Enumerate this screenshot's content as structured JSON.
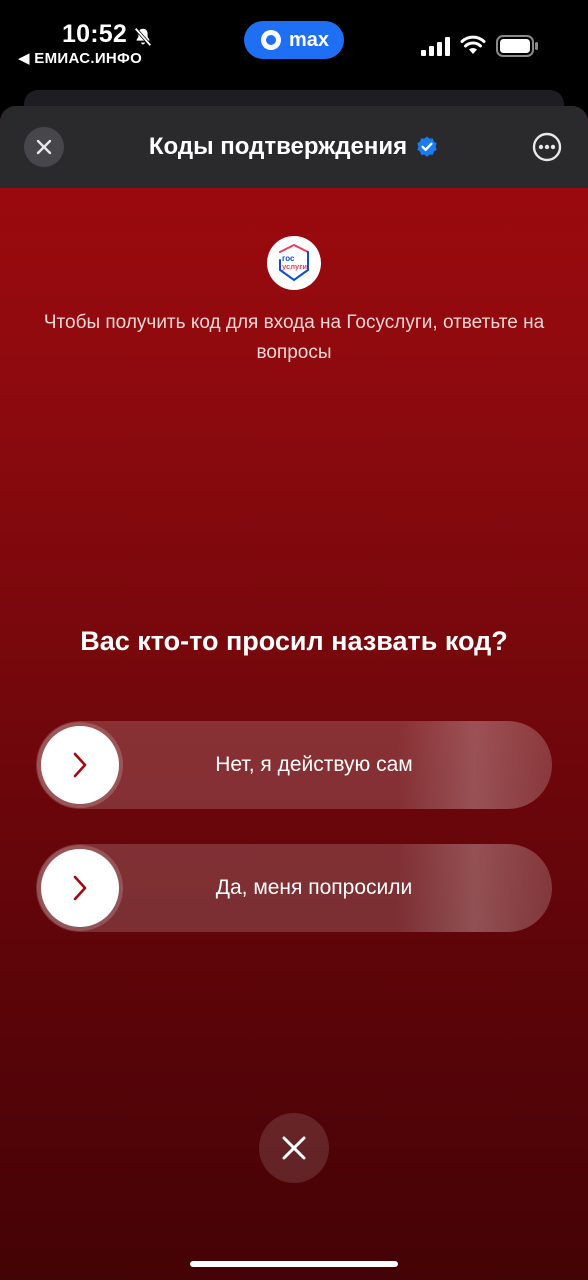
{
  "status_bar": {
    "time": "10:52",
    "back_app": "◀ ЕМИАС.ИНФО",
    "pill_label": "max",
    "pill_color": "#1f6ff4",
    "icons": [
      "bell-off-icon",
      "signal-icon",
      "wifi-icon",
      "battery-icon"
    ]
  },
  "header": {
    "title": "Коды подтверждения",
    "verified_color": "#1a7cf0",
    "close_icon": "close-icon",
    "more_icon": "more-icon"
  },
  "content": {
    "logo_icon": "gosuslugi-logo",
    "logo_text_top": "гос",
    "logo_text_bottom": "услуги",
    "intro": "Чтобы получить код для входа на Госуслуги, ответьте на вопросы",
    "question": "Вас кто-то просил назвать код?",
    "choices": [
      {
        "label": "Нет, я действую сам"
      },
      {
        "label": "Да, меня попросили"
      }
    ],
    "accent_color": "#a0090d"
  }
}
